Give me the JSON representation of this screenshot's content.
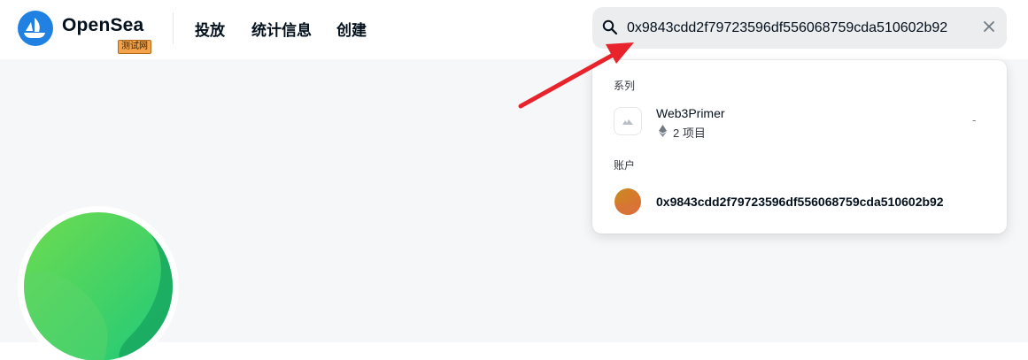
{
  "header": {
    "brand": "OpenSea",
    "testnet_badge": "测试网",
    "nav": {
      "drops": "投放",
      "stats": "统计信息",
      "create": "创建"
    },
    "search": {
      "value": "0x9843cdd2f79723596df556068759cda510602b92"
    }
  },
  "dropdown": {
    "collections_title": "系列",
    "collection": {
      "name": "Web3Primer",
      "count": "2 项目",
      "trailing": "-"
    },
    "accounts_title": "账户",
    "account": {
      "address": "0x9843cdd2f79723596df556068759cda510602b92"
    }
  },
  "icons": {
    "logo": "opensea-logo-icon",
    "search": "search-icon",
    "clear": "close-icon",
    "collection_thumb": "image-placeholder-icon",
    "currency": "ethereum-icon",
    "annotation": "red-arrow-icon"
  },
  "colors": {
    "brand_blue": "#2081e2",
    "badge_orange": "#f4a34b",
    "annotation_red": "#e8232b",
    "avatar_green": "#34c759"
  }
}
